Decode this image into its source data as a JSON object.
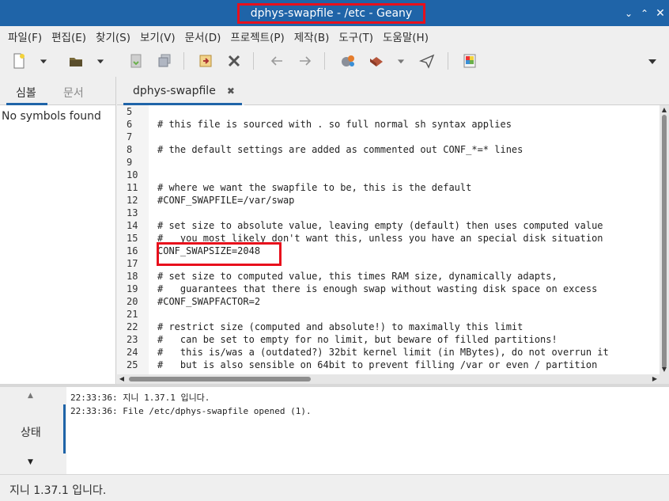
{
  "window": {
    "title": "dphys-swapfile - /etc - Geany"
  },
  "menu": [
    "파일(F)",
    "편집(E)",
    "찾기(S)",
    "보기(V)",
    "문서(D)",
    "프로젝트(P)",
    "제작(B)",
    "도구(T)",
    "도움말(H)"
  ],
  "sidebar": {
    "tabs": [
      "심볼",
      "문서"
    ],
    "empty_message": "No symbols found"
  },
  "editor": {
    "tab_label": "dphys-swapfile",
    "lines": [
      {
        "n": "5",
        "t": ""
      },
      {
        "n": "6",
        "t": "# this file is sourced with . so full normal sh syntax applies"
      },
      {
        "n": "7",
        "t": ""
      },
      {
        "n": "8",
        "t": "# the default settings are added as commented out CONF_*=* lines"
      },
      {
        "n": "9",
        "t": ""
      },
      {
        "n": "10",
        "t": ""
      },
      {
        "n": "11",
        "t": "# where we want the swapfile to be, this is the default"
      },
      {
        "n": "12",
        "t": "#CONF_SWAPFILE=/var/swap"
      },
      {
        "n": "13",
        "t": ""
      },
      {
        "n": "14",
        "t": "# set size to absolute value, leaving empty (default) then uses computed value"
      },
      {
        "n": "15",
        "t": "#   you most likely don't want this, unless you have an special disk situation"
      },
      {
        "n": "16",
        "t": "CONF_SWAPSIZE=2048"
      },
      {
        "n": "17",
        "t": ""
      },
      {
        "n": "18",
        "t": "# set size to computed value, this times RAM size, dynamically adapts,"
      },
      {
        "n": "19",
        "t": "#   guarantees that there is enough swap without wasting disk space on excess"
      },
      {
        "n": "20",
        "t": "#CONF_SWAPFACTOR=2"
      },
      {
        "n": "21",
        "t": ""
      },
      {
        "n": "22",
        "t": "# restrict size (computed and absolute!) to maximally this limit"
      },
      {
        "n": "23",
        "t": "#   can be set to empty for no limit, but beware of filled partitions!"
      },
      {
        "n": "24",
        "t": "#   this is/was a (outdated?) 32bit kernel limit (in MBytes), do not overrun it"
      },
      {
        "n": "25",
        "t": "#   but is also sensible on 64bit to prevent filling /var or even / partition"
      }
    ]
  },
  "messages": {
    "tab_label": "상태",
    "lines": [
      "22:33:36: 지니 1.37.1 입니다.",
      "22:33:36: File /etc/dphys-swapfile opened (1)."
    ]
  },
  "statusbar": {
    "text": "지니 1.37.1 입니다."
  },
  "colors": {
    "titlebar": "#1f64a8",
    "highlight_box": "#e8101c",
    "accent": "#1f64a8"
  }
}
